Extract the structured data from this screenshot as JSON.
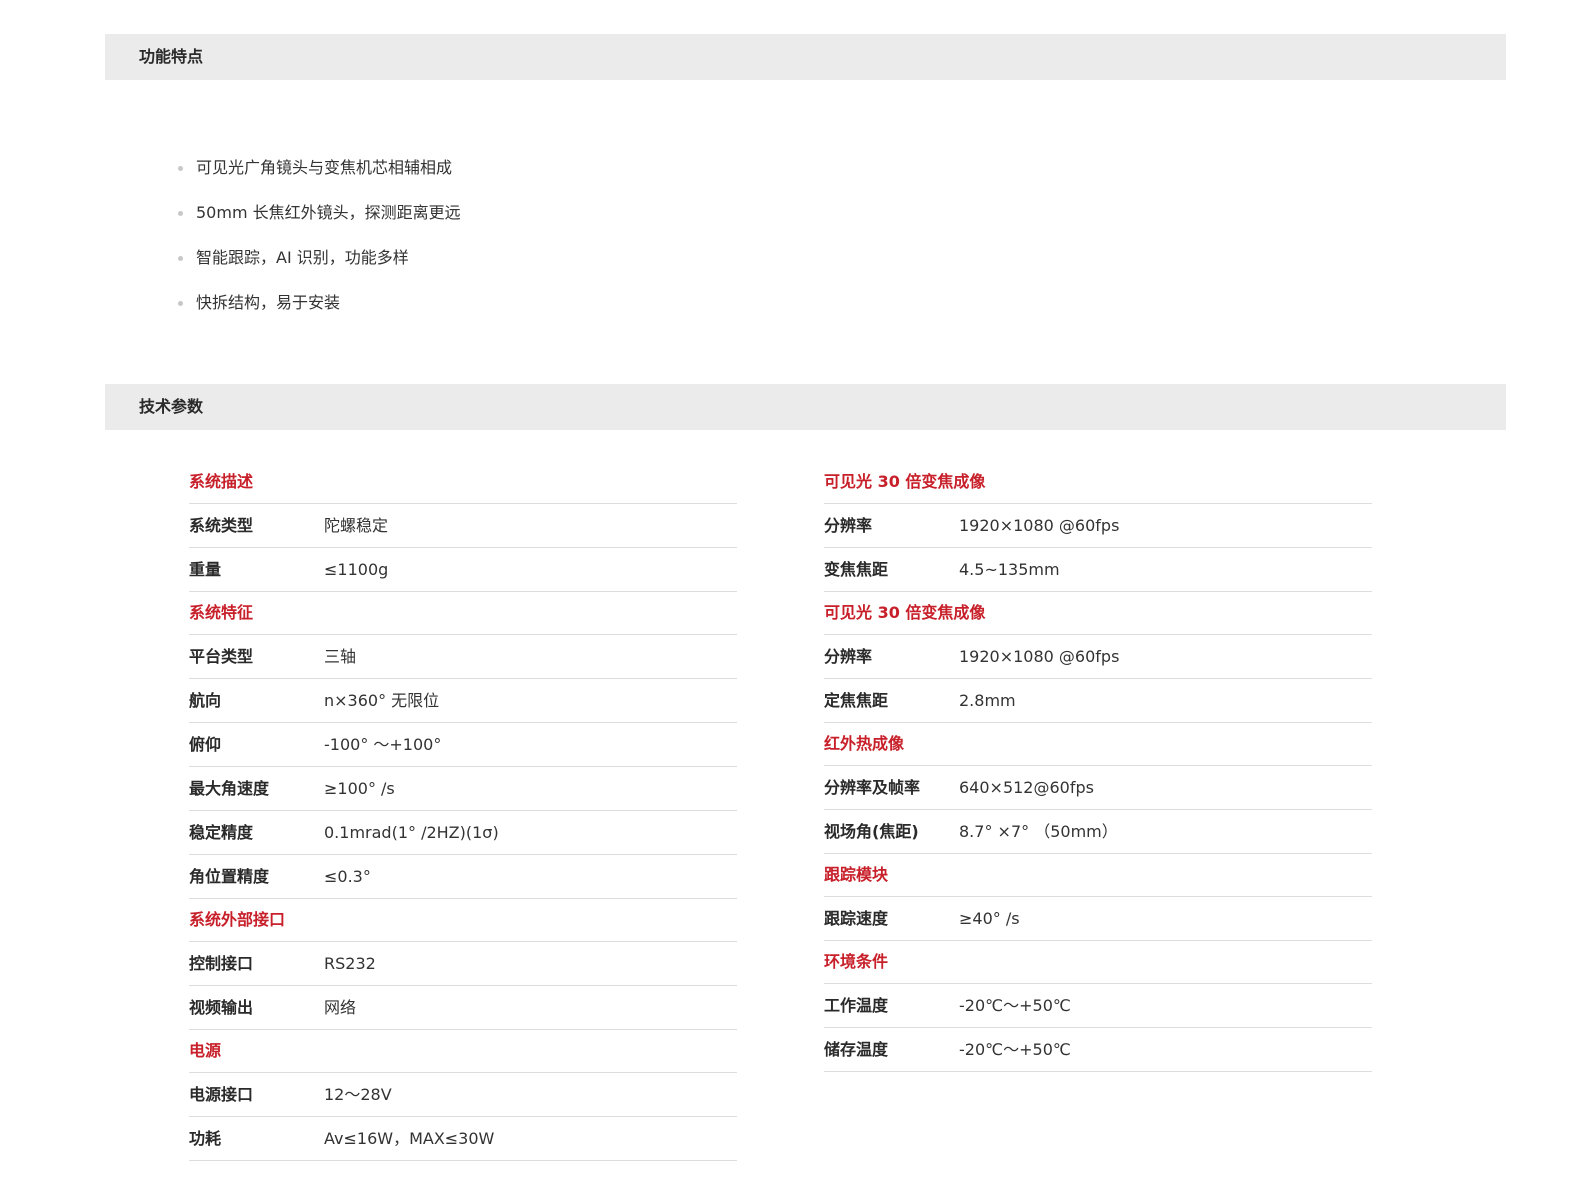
{
  "features": {
    "title": "功能特点",
    "items": [
      "可见光广角镜头与变焦机芯相辅相成",
      "50mm 长焦红外镜头，探测距离更远",
      "智能跟踪，AI 识别，功能多样",
      "快拆结构，易于安装"
    ]
  },
  "specs": {
    "title": "技术参数",
    "left": [
      {
        "title": "系统描述",
        "rows": [
          {
            "label": "系统类型",
            "value": "陀螺稳定"
          },
          {
            "label": "重量",
            "value": "≤1100g"
          }
        ]
      },
      {
        "title": "系统特征",
        "rows": [
          {
            "label": "平台类型",
            "value": "三轴"
          },
          {
            "label": "航向",
            "value": "n×360°  无限位"
          },
          {
            "label": "俯仰",
            "value": "-100° ～+100°"
          },
          {
            "label": "最大角速度",
            "value": "≥100° /s"
          },
          {
            "label": "稳定精度",
            "value": "0.1mrad(1° /2HZ)(1σ)"
          },
          {
            "label": "角位置精度",
            "value": "≤0.3°"
          }
        ]
      },
      {
        "title": "系统外部接口",
        "rows": [
          {
            "label": "控制接口",
            "value": "RS232"
          },
          {
            "label": "视频输出",
            "value": "网络"
          }
        ]
      },
      {
        "title": "电源",
        "rows": [
          {
            "label": "电源接口",
            "value": "12～28V"
          },
          {
            "label": "功耗",
            "value": "Av≤16W，MAX≤30W"
          }
        ]
      }
    ],
    "right": [
      {
        "title": "可见光 30 倍变焦成像",
        "rows": [
          {
            "label": "分辨率",
            "value": "1920×1080 @60fps"
          },
          {
            "label": "变焦焦距",
            "value": "4.5~135mm"
          }
        ]
      },
      {
        "title": "可见光 30 倍变焦成像",
        "rows": [
          {
            "label": "分辨率",
            "value": "1920×1080 @60fps"
          },
          {
            "label": "定焦焦距",
            "value": "2.8mm"
          }
        ]
      },
      {
        "title": "红外热成像",
        "rows": [
          {
            "label": "分辨率及帧率",
            "value": "640×512@60fps"
          },
          {
            "label": "视场角(焦距)",
            "value": "8.7° ×7° （50mm）"
          }
        ]
      },
      {
        "title": "跟踪模块",
        "rows": [
          {
            "label": "跟踪速度",
            "value": "≥40° /s"
          }
        ]
      },
      {
        "title": "环境条件",
        "rows": [
          {
            "label": "工作温度",
            "value": "-20℃～+50℃"
          },
          {
            "label": "储存温度",
            "value": "-20℃～+50℃"
          }
        ]
      }
    ]
  }
}
